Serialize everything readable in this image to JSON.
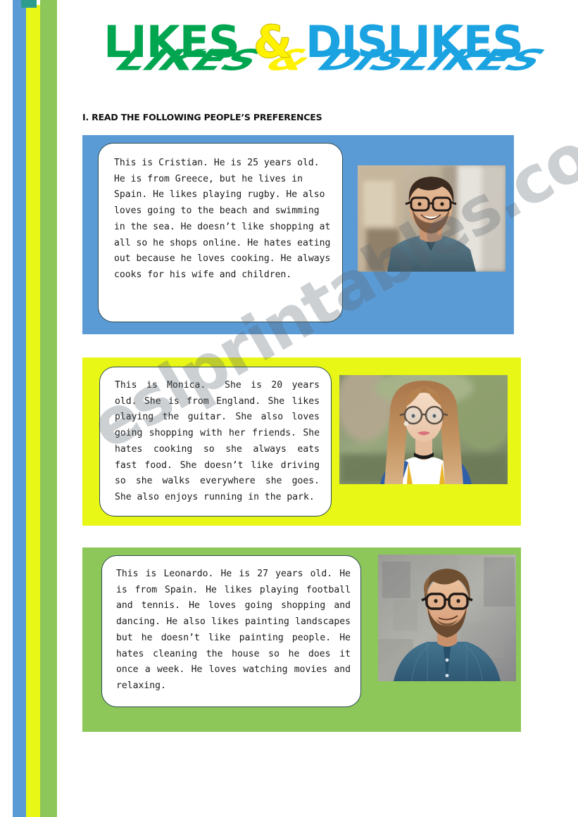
{
  "document": {
    "title_parts": {
      "likes": "LIKES",
      "amp": "&",
      "dislikes": "DISLIKES"
    },
    "title_full": "LIKES & DISLIKES",
    "instruction": "I. READ THE FOLLOWING PEOPLE’S PREFERENCES",
    "watermark": "eslprintables.com"
  },
  "colors": {
    "stripe_blue": "#5b9bd5",
    "stripe_yellow": "#e8f715",
    "stripe_green": "#8dc75a",
    "stripe_teal": "#2e9b8f",
    "title_likes": "#00a550",
    "title_amp": "#fff200",
    "title_dislikes": "#1aa3e0",
    "title_shadow": "#aab58a",
    "panel_blue": "#5b9bd5",
    "panel_yellow": "#e8f715",
    "panel_green": "#8dc75a",
    "bubble_border": "#2c4a52",
    "bubble_fill": "#ffffff",
    "text": "#1a1a1a"
  },
  "people": [
    {
      "name": "Cristian",
      "age": "25",
      "panel_color": "blue",
      "text": "This is Cristian. He is 25 years old. He is from Greece, but he lives in Spain. He likes playing rugby. He also loves going to the beach and swimming in the sea. He doesn’t like shopping at all so he shops online. He hates eating out because he loves cooking. He always cooks for his wife and children.",
      "photo_alt": "Smiling young man with glasses and a short beard wearing a teal t-shirt, indoors"
    },
    {
      "name": "Monica",
      "age": "20",
      "panel_color": "yellow",
      "text": "This is Monica.  She is 20 years old. She is from England. She likes playing the guitar. She also loves going shopping with her friends. She hates cooking so she always eats fast food. She doesn’t like driving so she walks everywhere she goes. She also enjoys running in the park.",
      "photo_alt": "Young woman with long strawberry-blonde hair, round glasses and a black choker, outdoors"
    },
    {
      "name": "Leonardo",
      "age": "27",
      "panel_color": "green",
      "text": "This is Leonardo. He is 27 years old. He is from Spain. He likes playing football and tennis. He loves going shopping and dancing. He also likes painting landscapes but he doesn’t like painting people. He hates cleaning the house so he does it once a week. He loves watching movies and relaxing.",
      "photo_alt": "Bearded man with glasses in a denim shirt in front of a grey concrete wall"
    }
  ]
}
